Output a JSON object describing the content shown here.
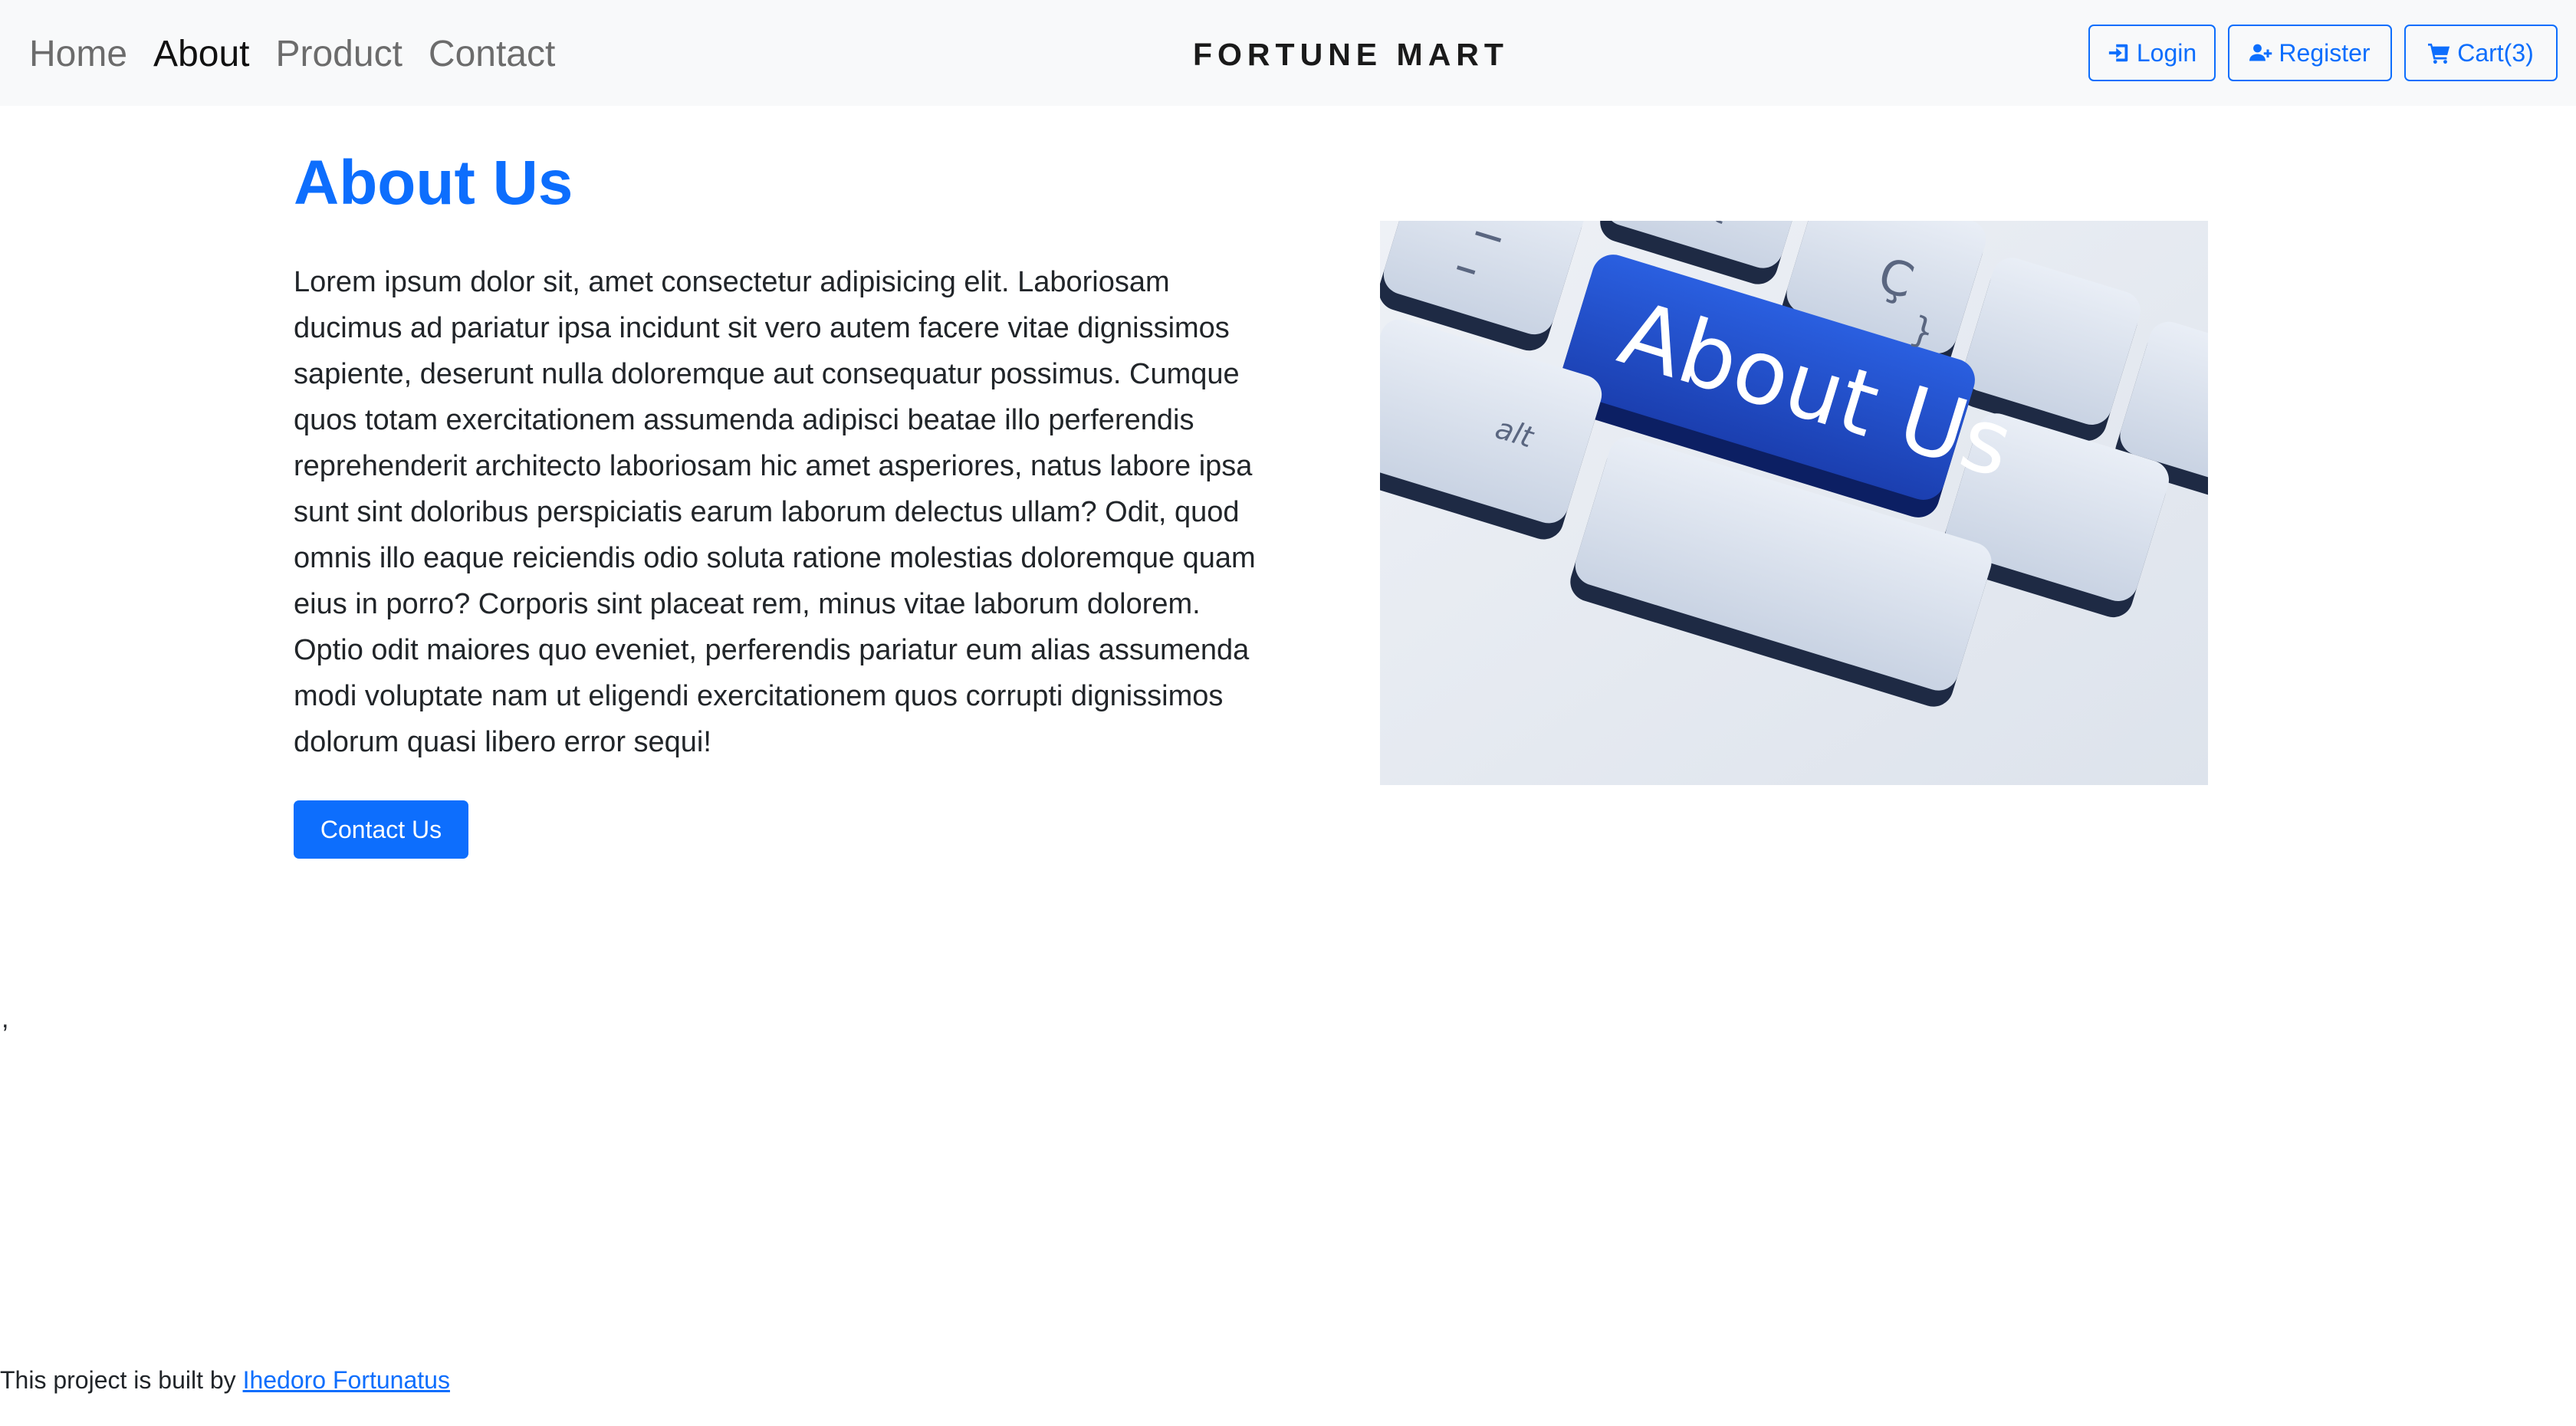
{
  "nav": {
    "links": [
      "Home",
      "About",
      "Product",
      "Contact"
    ],
    "active": "About",
    "brand": "FORTUNE MART",
    "login_label": "Login",
    "register_label": "Register",
    "cart_label": "Cart(3)"
  },
  "about": {
    "title": "About Us",
    "body": "Lorem ipsum dolor sit, amet consectetur adipisicing elit. Laboriosam ducimus ad pariatur ipsa incidunt sit vero autem facere vitae dignissimos sapiente, deserunt nulla doloremque aut consequatur possimus. Cumque quos totam exercitationem assumenda adipisci beatae illo perferendis reprehenderit architecto laboriosam hic amet asperiores, natus labore ipsa sunt sint doloribus perspiciatis earum laborum delectus ullam? Odit, quod omnis illo eaque reiciendis odio soluta ratione molestias doloremque quam eius in porro? Corporis sint placeat rem, minus vitae laborum dolorem. Optio odit maiores quo eveniet, perferendis pariatur eum alias assumenda modi voluptate nam ut eligendi exercitationem quos corrupti dignissimos dolorum quasi libero error sequi!",
    "contact_button": "Contact Us",
    "image_key_label": "About Us",
    "image_key_glyphs": [
      "Ç",
      "alt",
      "{",
      "}"
    ]
  },
  "misc": {
    "stray_text": ","
  },
  "footer": {
    "prefix": "This project is built by ",
    "author_link": "Ihedoro Fortunatus"
  },
  "colors": {
    "accent": "#0d6efd",
    "navbar_bg": "#f8f9fa",
    "key_blue": "#1f4fc8"
  },
  "icons": [
    "sign-in-icon",
    "user-plus-icon",
    "cart-icon"
  ]
}
